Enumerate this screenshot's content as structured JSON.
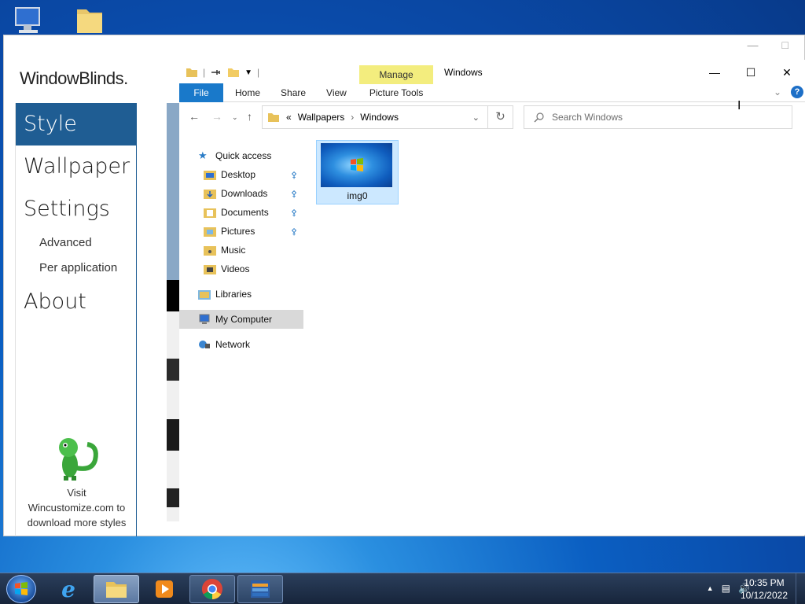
{
  "windowblinds": {
    "logo": "WindowBlinds.",
    "nav": [
      {
        "label": "Style",
        "active": true
      },
      {
        "label": "Wallpaper"
      },
      {
        "label": "Settings"
      }
    ],
    "subnav": [
      "Advanced",
      "Per application"
    ],
    "about": "About",
    "promo_lines": [
      "Visit",
      "Wincustomize.com to",
      "download more styles"
    ]
  },
  "explorer": {
    "title": "Windows",
    "manage_tab": "Manage",
    "ribbon_tabs": [
      "File",
      "Home",
      "Share",
      "View",
      "Picture Tools"
    ],
    "breadcrumb": [
      "Wallpapers",
      "Windows"
    ],
    "breadcrumb_prefix": "«",
    "search_placeholder": "Search Windows",
    "nav_pane": {
      "quick_access": "Quick access",
      "quick_items": [
        {
          "label": "Desktop",
          "pinned": true
        },
        {
          "label": "Downloads",
          "pinned": true
        },
        {
          "label": "Documents",
          "pinned": true
        },
        {
          "label": "Pictures",
          "pinned": true
        },
        {
          "label": "Music",
          "pinned": false
        },
        {
          "label": "Videos",
          "pinned": false
        }
      ],
      "libraries": "Libraries",
      "my_computer": "My Computer",
      "network": "Network"
    },
    "files": [
      {
        "name": "img0",
        "selected": true
      }
    ]
  },
  "taskbar": {
    "apps": [
      "internet-explorer",
      "file-explorer",
      "media-player",
      "chrome",
      "windowblinds"
    ],
    "time": "10:35 PM",
    "date": "10/12/2022"
  },
  "colors": {
    "wb_accent": "#1f5d93",
    "file_tab": "#1979ca",
    "manage_tab": "#f3ed7e",
    "selection": "#cce8ff"
  }
}
